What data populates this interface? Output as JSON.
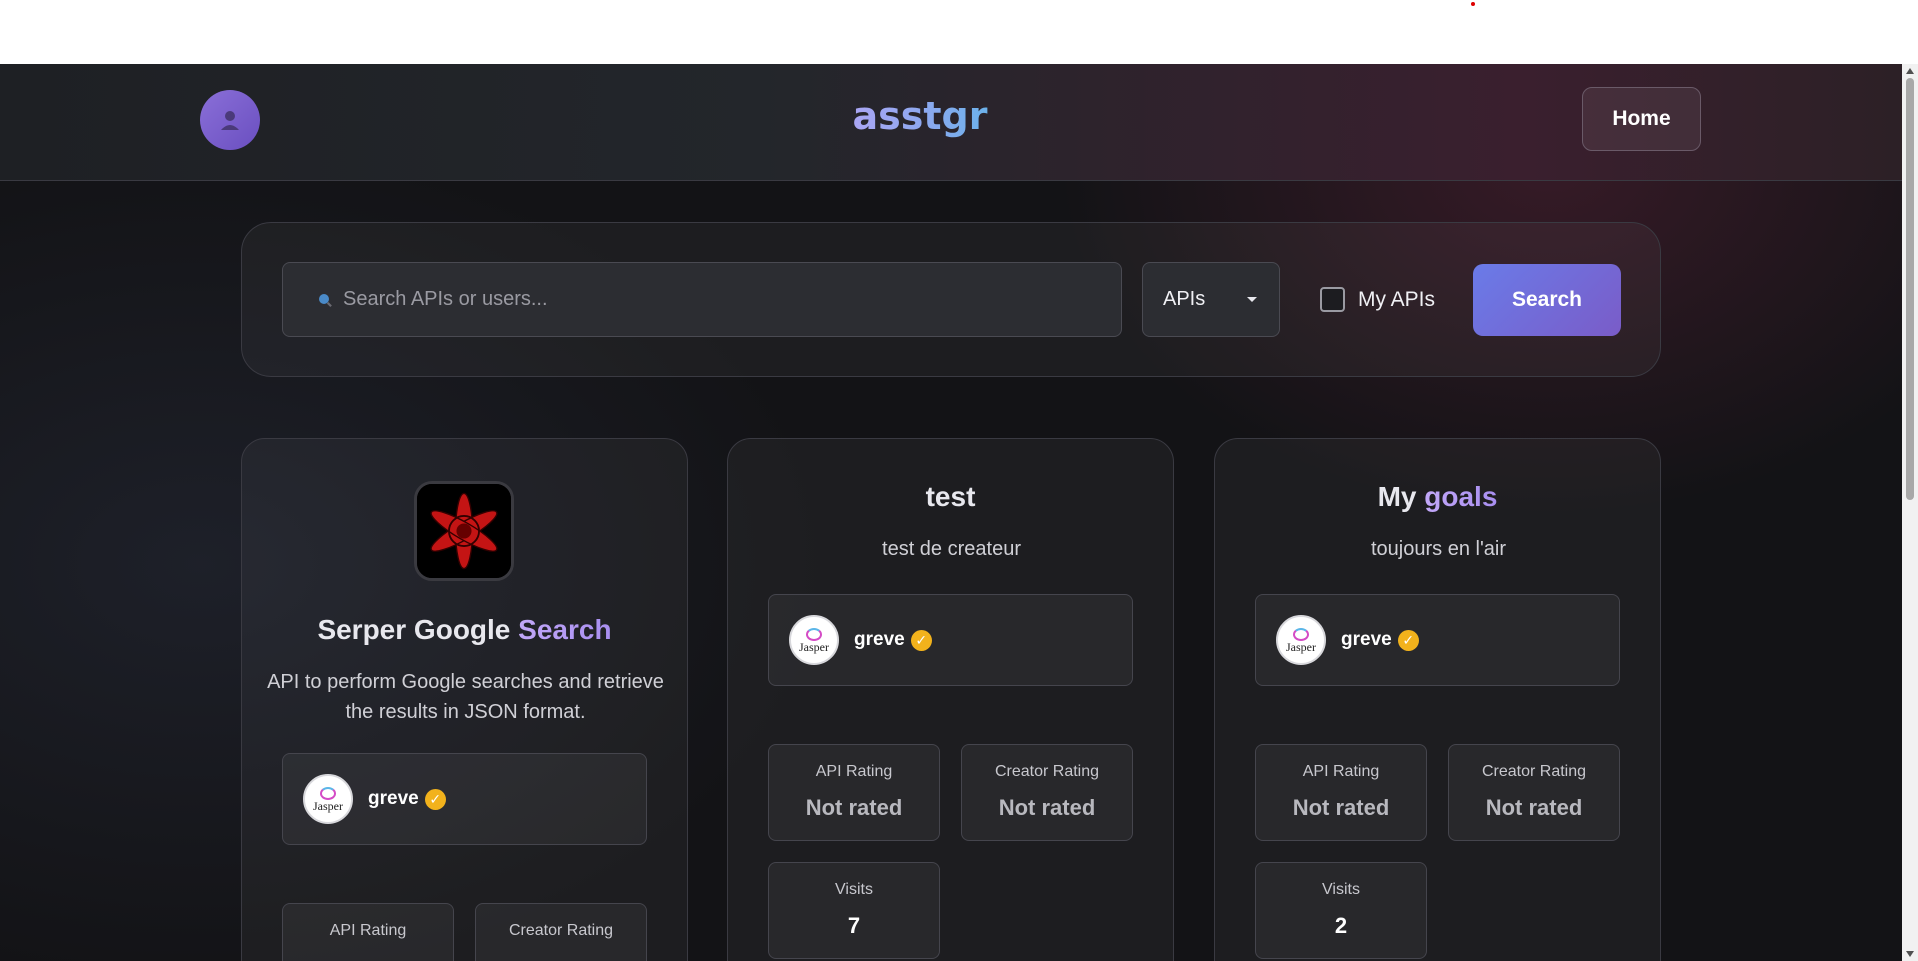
{
  "navbar": {
    "brand": "asstgr",
    "home_label": "Home",
    "avatar_icon": "user-icon"
  },
  "search": {
    "placeholder": "Search APIs or users...",
    "value": "",
    "type_selected": "APIs",
    "my_apis_label": "My APIs",
    "my_apis_checked": false,
    "button_label": "Search"
  },
  "cards": [
    {
      "title_plain": "Serper Google",
      "title_accent": "Search",
      "description": "API to perform Google searches and retrieve the results in JSON format.",
      "logo_icon": "serper-star-icon",
      "creator": {
        "name": "greve",
        "verified": true,
        "avatar_text": "Jasper"
      },
      "stats": {
        "api_rating_label": "API Rating",
        "creator_rating_label": "Creator Rating"
      }
    },
    {
      "title_plain": "test",
      "title_accent": "",
      "description": "test de createur",
      "creator": {
        "name": "greve",
        "verified": true,
        "avatar_text": "Jasper"
      },
      "stats": {
        "api_rating_label": "API Rating",
        "api_rating_value": "Not rated",
        "creator_rating_label": "Creator Rating",
        "creator_rating_value": "Not rated",
        "visits_label": "Visits",
        "visits_value": "7"
      }
    },
    {
      "title_plain": "My",
      "title_accent": "goals",
      "description": "toujours en l'air",
      "creator": {
        "name": "greve",
        "verified": true,
        "avatar_text": "Jasper"
      },
      "stats": {
        "api_rating_label": "API Rating",
        "api_rating_value": "Not rated",
        "creator_rating_label": "Creator Rating",
        "creator_rating_value": "Not rated",
        "visits_label": "Visits",
        "visits_value": "2"
      }
    }
  ],
  "colors": {
    "accent_gradient_start": "#6a7be8",
    "accent_gradient_end": "#7a5cc8",
    "verified_badge": "#f2b21c",
    "background": "#131316"
  }
}
